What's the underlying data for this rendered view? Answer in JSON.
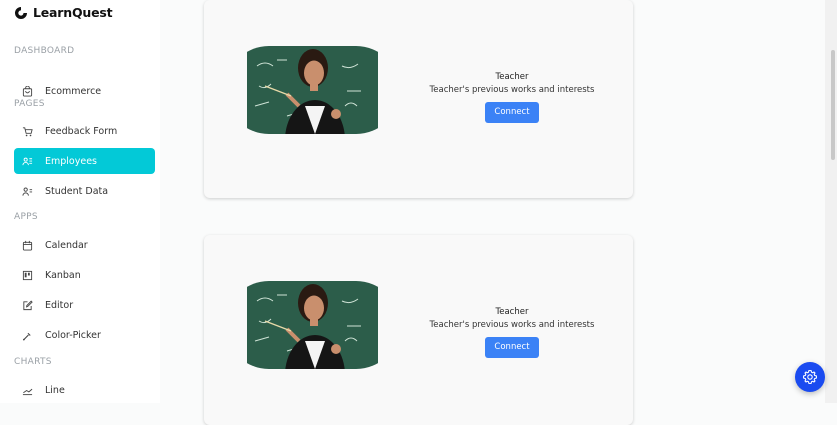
{
  "app": {
    "brand": "LearnQuest"
  },
  "sidebar": {
    "sections": [
      {
        "label": "DASHBOARD"
      },
      {
        "label": "PAGES"
      },
      {
        "label": "APPS"
      },
      {
        "label": "CHARTS"
      }
    ],
    "items": [
      {
        "label": "Ecommerce",
        "icon": "shopping-bag-icon"
      },
      {
        "label": "Feedback Form",
        "icon": "cart-icon"
      },
      {
        "label": "Employees",
        "icon": "employees-icon",
        "active": true
      },
      {
        "label": "Student Data",
        "icon": "contacts-icon"
      },
      {
        "label": "Calendar",
        "icon": "calendar-icon"
      },
      {
        "label": "Kanban",
        "icon": "kanban-icon"
      },
      {
        "label": "Editor",
        "icon": "edit-icon"
      },
      {
        "label": "Color-Picker",
        "icon": "color-picker-icon"
      },
      {
        "label": "Line",
        "icon": "line-chart-icon"
      }
    ]
  },
  "cards": [
    {
      "role": "Teacher",
      "description": "Teacher's previous works and interests",
      "button": "Connect",
      "image": "teacher-photo"
    },
    {
      "role": "Teacher",
      "description": "Teacher's previous works and interests",
      "button": "Connect",
      "image": "teacher-photo"
    }
  ],
  "colors": {
    "accent": "#03c9d7",
    "button": "#3b82f6",
    "fab": "#1a4bf0"
  },
  "fab": {
    "icon": "gear-icon"
  }
}
